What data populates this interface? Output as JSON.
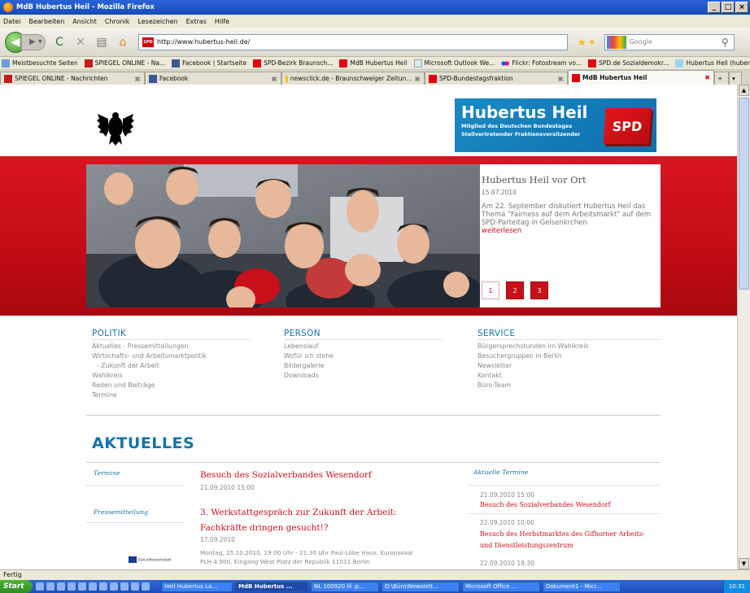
{
  "window": {
    "title": "MdB Hubertus Heil - Mozilla Firefox"
  },
  "menu": [
    "Datei",
    "Bearbeiten",
    "Ansicht",
    "Chronik",
    "Lesezeichen",
    "Extras",
    "Hilfe"
  ],
  "navbar": {
    "url": "http://www.hubertus-heil.de/",
    "search_placeholder": "Google"
  },
  "bookmarks": [
    "Meistbesuchte Seiten",
    "SPIEGEL ONLINE - Na...",
    "Facebook | Startseite",
    "SPD-Bezirk Braunsch...",
    "MdB Hubertus Heil",
    "Microsoft Outlook We...",
    "Flickr: Fotostream vo...",
    "SPD.de Sozialdemokr...",
    "Hubertus Heil (hubert..."
  ],
  "tabs": [
    "SPIEGEL ONLINE - Nachrichten",
    "Facebook",
    "newsclick.de - Braunschweiger Zeitun...",
    "SPD-Bundestagsfraktion",
    "MdB Hubertus Heil"
  ],
  "logo": {
    "name": "Hubertus Heil",
    "sub1": "Mitglied des Deutschen Bundestages",
    "sub2": "Stellvertretender Fraktionsvorsitzender",
    "party": "SPD"
  },
  "feature": {
    "title": "Hubertus Heil vor Ort",
    "date": "15.07.2010",
    "text": "Am 22. September diskutiert Hubertus Heil das Thema \"Fairness auf dem Arbeitsmarkt\" auf dem SPD-Parteitag in Gelsenkrchen",
    "more": "weiterlesen",
    "pages": [
      "1",
      "2",
      "3"
    ]
  },
  "nav": {
    "politik": {
      "heading": "POLITIK",
      "items": [
        "Aktuelles - Pressemitteilungen",
        "Wirtschafts- und Arbeitsmarktpolitik",
        "- Zukunft der Arbeit",
        "Wahlkreis",
        "Reden und Beiträge",
        "Termine"
      ]
    },
    "person": {
      "heading": "PERSON",
      "items": [
        "Lebenslauf",
        "Wofür ich stehe",
        "Bildergalerie",
        "Downloads"
      ]
    },
    "service": {
      "heading": "SERVICE",
      "items": [
        "Bürgersprechstunden im Wahlkreis",
        "Besuchergruppen in Berlin",
        "Newsletter",
        "Kontakt",
        "Büro-Team"
      ]
    }
  },
  "aktuelles": {
    "heading": "AKTUELLES",
    "articles": [
      {
        "category": "Termine",
        "title": "Besuch des Sozialverbandes Wesendorf",
        "date": "21.09.2010 15:00"
      },
      {
        "category": "Pressemitteilung",
        "title1": "3. Werkstattgespräch zur Zukunft der Arbeit:",
        "title2": "Fachkräfte dringen gesucht!?",
        "date": "17.09.2010",
        "text1": "Montag, 25.10.2010, 19:00 Uhr - 21:30 Uhr Paul-Löbe Haus, Europasaal",
        "text2": "PLH 4.900, Eingang West Platz der Republik 11011 Berlin"
      }
    ],
    "thumb_label": "Zukunftswerkstatt"
  },
  "termine": {
    "heading": "Aktuelle Termine",
    "items": [
      {
        "date": "21.09.2010 15:00",
        "title": "Besuch des Sozialverbandes Wesendorf"
      },
      {
        "date": "22.09.2010 10:00",
        "title": "Besuch des Herbstmarktes des Gifhorner Arbeits- und Dienstleistungszentrum"
      },
      {
        "date": "22.09.2010 18:30",
        "title": ""
      }
    ]
  },
  "status": "Fertig",
  "taskbar": {
    "start": "Start",
    "items": [
      "Heil Hubertus La...",
      "MdB Hubertus ...",
      "NL 100920 lli .p...",
      "D:\\Büro\\Newslett...",
      "Microsoft Office ...",
      "Dokument1 - Micr..."
    ],
    "clock": "10:31"
  }
}
